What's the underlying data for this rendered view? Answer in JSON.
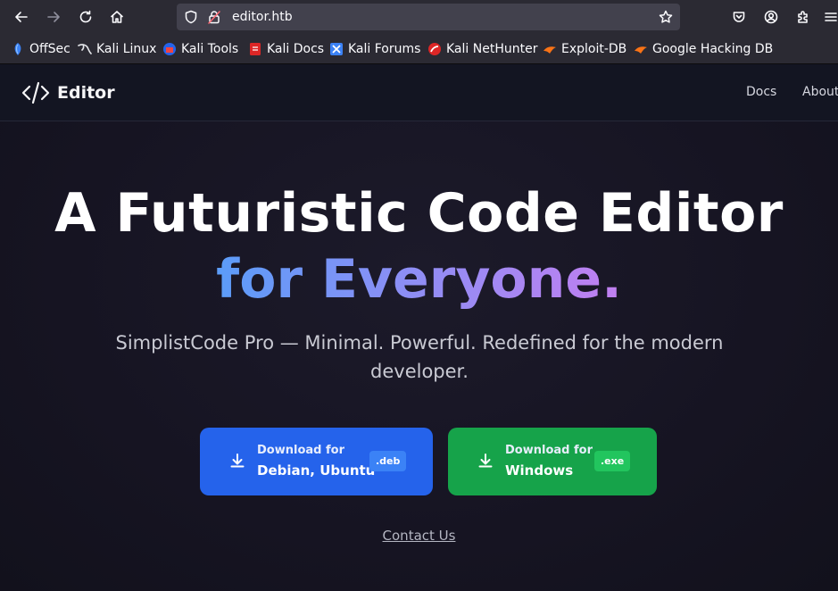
{
  "browser": {
    "url": "editor.htb",
    "bookmarks": [
      {
        "label": "OffSec",
        "color": "#3b82f6"
      },
      {
        "label": "Kali Linux",
        "color": "#e5e7eb"
      },
      {
        "label": "Kali Tools",
        "color": "#ef4444"
      },
      {
        "label": "Kali Docs",
        "color": "#dc2626"
      },
      {
        "label": "Kali Forums",
        "color": "#3b82f6"
      },
      {
        "label": "Kali NetHunter",
        "color": "#dc2626"
      },
      {
        "label": "Exploit-DB",
        "color": "#f97316"
      },
      {
        "label": "Google Hacking DB",
        "color": "#f97316"
      }
    ]
  },
  "site": {
    "logo_text": "Editor",
    "nav": [
      "Docs",
      "About"
    ]
  },
  "hero": {
    "title_line1": "A Futuristic Code Editor",
    "title_line2": "for Everyone.",
    "subtitle": "SimplistCode Pro — Minimal. Powerful. Redefined for the modern developer."
  },
  "downloads": [
    {
      "small": "Download for",
      "big": "Debian, Ubuntu",
      "badge": ".deb",
      "color": "#2563eb"
    },
    {
      "small": "Download for",
      "big": "Windows",
      "badge": ".exe",
      "color": "#16a34a"
    }
  ],
  "contact_label": "Contact Us"
}
